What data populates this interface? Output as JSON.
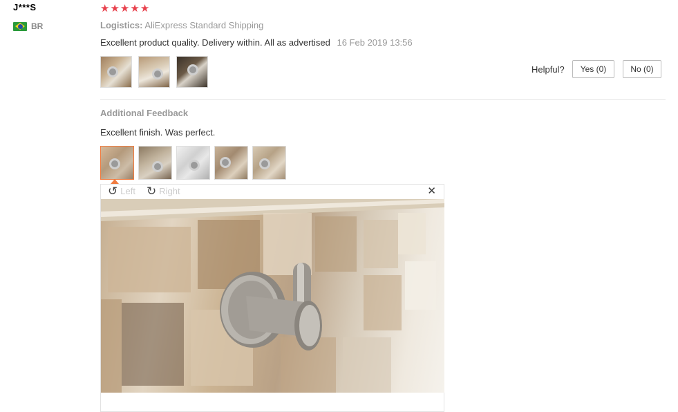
{
  "reviewer": {
    "name": "J***S",
    "country_code": "BR",
    "flag_icon": "brazil-flag-icon"
  },
  "review": {
    "rating": 5,
    "rating_max": 5,
    "star_color": "#e8414d",
    "logistics_label": "Logistics:",
    "logistics_value": "AliExpress Standard Shipping",
    "text": "Excellent product quality. Delivery within. All as advertised",
    "date": "16 Feb 2019 13:56",
    "photo_count": 3
  },
  "helpful": {
    "label": "Helpful?",
    "yes_label": "Yes (0)",
    "no_label": "No (0)"
  },
  "additional_feedback": {
    "title": "Additional Feedback",
    "text": "Excellent finish. Was perfect.",
    "photo_count": 5,
    "selected_photo_index": 0
  },
  "viewer": {
    "rotate_left_label": "Left",
    "rotate_right_label": "Right",
    "rotate_left_icon": "rotate-left-icon",
    "rotate_right_icon": "rotate-right-icon",
    "close_icon": "close-icon",
    "close_glyph": "✕",
    "accent_color": "#f07b3f"
  }
}
